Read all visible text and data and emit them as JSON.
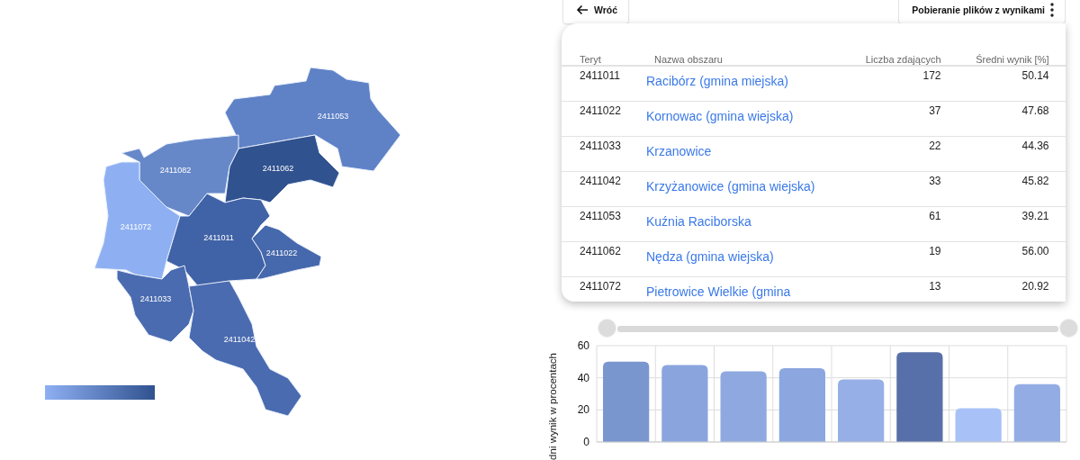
{
  "map": {
    "regions": [
      {
        "label": "2411053",
        "color": "#5f82c6"
      },
      {
        "label": "2411062",
        "color": "#30528f"
      },
      {
        "label": "2411082",
        "color": "#6688c8"
      },
      {
        "label": "2411072",
        "color": "#8eb0f3"
      },
      {
        "label": "2411011",
        "color": "#4062a6"
      },
      {
        "label": "2411022",
        "color": "#4668ac"
      },
      {
        "label": "2411033",
        "color": "#4a6bb0"
      },
      {
        "label": "2411042",
        "color": "#4a6bb0"
      }
    ]
  },
  "toolbar": {
    "back_button": "Wróć",
    "download_button": "Pobieranie plików z wynikami"
  },
  "table": {
    "columns": [
      "Teryt",
      "Nazwa obszaru",
      "Liczba zdających",
      "Średni wynik [%]"
    ],
    "rows": [
      [
        "2411011",
        "Racibórz (gmina miejska)",
        "172",
        "50.14"
      ],
      [
        "2411022",
        "Kornowac (gmina wiejska)",
        "37",
        "47.68"
      ],
      [
        "2411033",
        "Krzanowice",
        "22",
        "44.36"
      ],
      [
        "2411042",
        "Krzyżanowice (gmina wiejska)",
        "33",
        "45.82"
      ],
      [
        "2411053",
        "Kuźnia Raciborska",
        "61",
        "39.21"
      ],
      [
        "2411062",
        "Nędza (gmina wiejska)",
        "19",
        "56.00"
      ],
      [
        "2411072",
        "Pietrowice Wielkie (gmina",
        "13",
        "20.92"
      ]
    ]
  },
  "zoom_slider": {
    "level": 1
  },
  "chart": {
    "chart_data": {
      "type": "bar",
      "ylabel": "dni wynik w procentach",
      "values": [
        50,
        48,
        44,
        46,
        39,
        56,
        21,
        36
      ],
      "colors": [
        "#7a96cf",
        "#8aa5dd",
        "#8fa9e0",
        "#8ca7df",
        "#96afe6",
        "#5870a9",
        "#a8c2f8",
        "#93ade4"
      ],
      "ylim": [
        0,
        60
      ],
      "yticks": [
        0,
        20,
        40,
        60
      ]
    }
  }
}
